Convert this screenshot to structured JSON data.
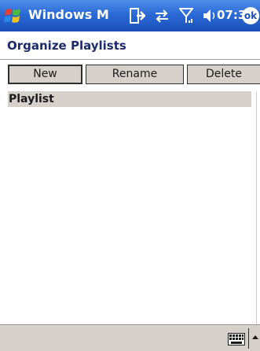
{
  "titlebar": {
    "app_title": "Windows M",
    "time": "07:37",
    "ok_label": "ok",
    "icons": [
      "start-menu-flag-icon",
      "activesync-icon",
      "connectivity-icon",
      "signal-strength-icon",
      "volume-icon"
    ]
  },
  "header": {
    "title": "Organize Playlists"
  },
  "toolbar": {
    "new_label": "New",
    "rename_label": "Rename",
    "delete_label": "Delete"
  },
  "list": {
    "column_header": "Playlist",
    "items": []
  },
  "menubar": {
    "icons": [
      "keyboard-icon",
      "input-panel-arrow-icon"
    ]
  },
  "colors": {
    "titlebar_blue": "#2a6ad6",
    "header_text": "#1c2a6b",
    "button_gray": "#d6d0cb"
  }
}
